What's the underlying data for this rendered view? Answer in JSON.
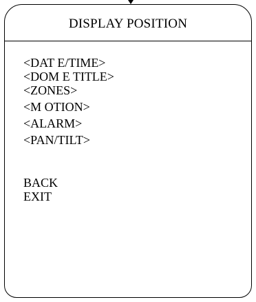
{
  "menu": {
    "title": "DISPLAY POSITION",
    "items": [
      {
        "label": "<DAT E/TIME>"
      },
      {
        "label": "<DOM E TITLE>"
      },
      {
        "label": "<ZONES>"
      },
      {
        "label": "<M OTION>"
      },
      {
        "label": "<ALARM>"
      },
      {
        "label": "<PAN/TILT>"
      },
      {
        "label": "BACK"
      },
      {
        "label": "EXIT"
      }
    ]
  }
}
